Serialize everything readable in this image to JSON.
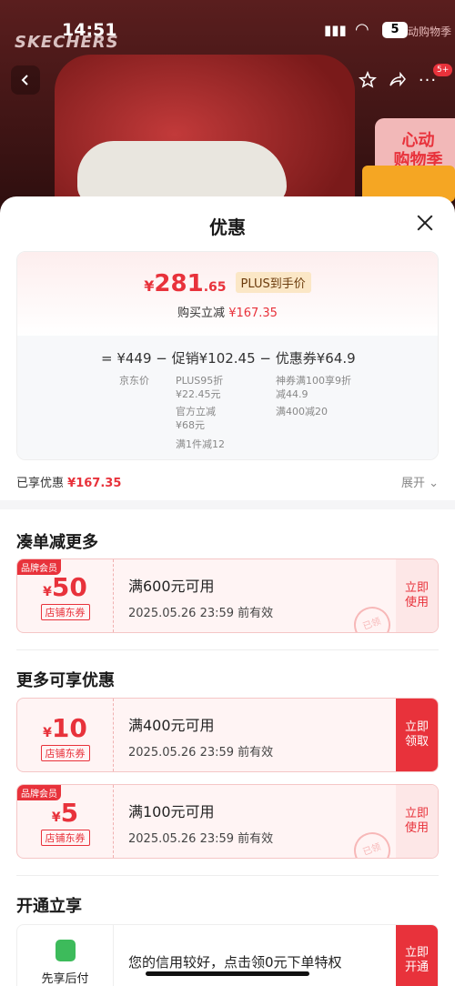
{
  "status_bar": {
    "time": "14:51",
    "battery": "5",
    "promo": "动购物季"
  },
  "background": {
    "brand_logo": "SKECHERS",
    "promo_badge_count": "5+",
    "promo_banner": "心动\n购物季"
  },
  "sheet": {
    "title": "优惠",
    "price_summary": {
      "yen": "¥",
      "price_int": "281",
      "price_dec": ".65",
      "plus_tag": "PLUS到手价",
      "lijian_label": "购买立减",
      "lijian_value": "¥167.35",
      "formula": "= ¥449 − 促销¥102.45 − 优惠券¥64.9",
      "jd_price_label": "京东价",
      "promo_items": [
        "PLUS95折\n¥22.45元",
        "官方立减\n¥68元",
        "满1件减12"
      ],
      "coupon_items": [
        "神券满100享9折\n减44.9",
        "满400减20"
      ]
    },
    "enjoyed_label": "已享优惠",
    "enjoyed_value": "¥167.35",
    "expand_label": "展开",
    "section_more_orders": "凑单减更多",
    "section_more_offers": "更多可享优惠",
    "section_open": "开通立享",
    "coupons": [
      {
        "member_tag": "品牌会员",
        "yen": "¥",
        "amount": "50",
        "type": "店铺东券",
        "condition": "满600元可用",
        "expiry": "2025.05.26 23:59 前有效",
        "action": "立即\n使用",
        "stamp": "已领"
      },
      {
        "member_tag": "",
        "yen": "¥",
        "amount": "10",
        "type": "店铺东券",
        "condition": "满400元可用",
        "expiry": "2025.05.26 23:59 前有效",
        "action": "立即\n领取",
        "stamp": ""
      },
      {
        "member_tag": "品牌会员",
        "yen": "¥",
        "amount": "5",
        "type": "店铺东券",
        "condition": "满100元可用",
        "expiry": "2025.05.26 23:59 前有效",
        "action": "立即\n使用",
        "stamp": "已领"
      }
    ],
    "open_offer": {
      "label": "先享后付",
      "text": "您的信用较好，点击领0元下单特权",
      "action": "立即\n开通"
    }
  },
  "colors": {
    "accent": "#e8323b"
  }
}
